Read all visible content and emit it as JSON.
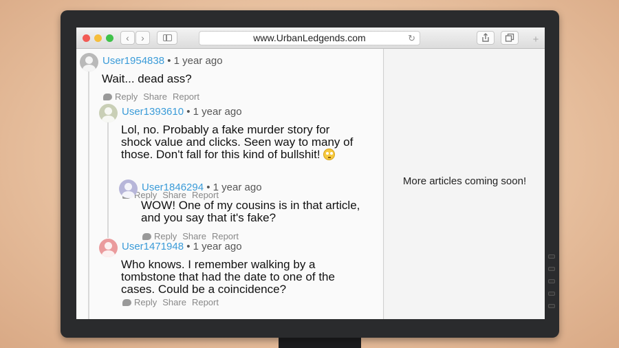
{
  "browser": {
    "url": "www.UrbanLedgends.com",
    "back_icon": "‹",
    "forward_icon": "›",
    "reload_icon": "↻",
    "plus_icon": "+"
  },
  "comments": [
    {
      "user": "User1954838",
      "time": "• 1 year ago",
      "text": "Wait... dead ass?",
      "avatar_color": "#b9b9b9",
      "actions": [
        "Reply",
        "Share",
        "Report"
      ]
    },
    {
      "user": "User1393610",
      "time": "• 1 year ago",
      "text": "Lol, no. Probably a fake murder story for shock value and clicks. Seen way to many of those. Don't fall for this kind of bullshit!",
      "emoji": "eye-roll-emoji",
      "avatar_color": "#c9cfb6",
      "actions": [
        "Reply",
        "Share",
        "Report"
      ]
    },
    {
      "user": "User1846294",
      "time": "• 1 year ago",
      "text": "WOW! One of my cousins is in that article, and you say that it's fake?",
      "avatar_color": "#b7b6d9",
      "actions": [
        "Reply",
        "Share",
        "Report"
      ]
    },
    {
      "user": "User1471948",
      "time": "• 1 year ago",
      "text": "Who knows. I remember walking by a tombstone that had the date to one of the cases. Could be a coincidence?",
      "avatar_color": "#ea9b9d",
      "actions": [
        "Reply",
        "Share",
        "Report"
      ]
    }
  ],
  "side_panel": {
    "message": "More articles coming soon!"
  },
  "colors": {
    "username": "#3a9bd8",
    "wall": "#e6bd9c",
    "monitor_bezel": "#2a2b2d"
  }
}
